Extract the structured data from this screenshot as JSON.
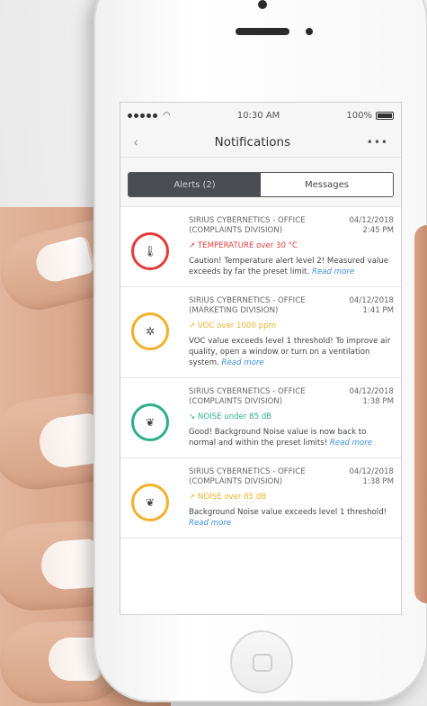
{
  "status_bar": {
    "time": "10:30 AM",
    "battery": "100%"
  },
  "nav": {
    "back": "‹",
    "title": "Notifications",
    "more": "•••"
  },
  "tabs": [
    {
      "label": "Alerts (2)",
      "active": true
    },
    {
      "label": "Messages",
      "active": false
    }
  ],
  "notifications": [
    {
      "org": "SIRIUS CYBERNETICS - OFFICE (COMPLAINTS DIVISION)",
      "date": "04/12/2018",
      "time": "2:45 PM",
      "metric": "↗ TEMPERATURE over 30 °C",
      "metric_color": "#e53b3b",
      "ring_color": "#e53b3b",
      "icon": "thermometer-icon",
      "glyph": "🌡",
      "description": "Caution! Temperature alert level 2! Measured value exceeds by far the preset limit.",
      "read_more": "Read more"
    },
    {
      "org": "SIRIUS CYBERNETICS - OFFICE (MARKETING DIVISION)",
      "date": "04/12/2018",
      "time": "1:41 PM",
      "metric": "↗ VOC over 1000 ppm",
      "metric_color": "#f2b12a",
      "ring_color": "#f2b12a",
      "icon": "voc-icon",
      "glyph": "✲",
      "description": "VOC value exceeds level 1 threshold! To improve air quality, open a window or turn on a ventilation system.",
      "read_more": "Read more"
    },
    {
      "org": "SIRIUS CYBERNETICS - OFFICE (COMPLAINTS DIVISION)",
      "date": "04/12/2018",
      "time": "1:38 PM",
      "metric": "↘ NOISE under 85 dB",
      "metric_color": "#2eae8a",
      "ring_color": "#2eae8a",
      "icon": "ear-icon",
      "glyph": "❦",
      "description": "Good! Background Noise value is now back to normal and within the preset limits!",
      "read_more": "Read more"
    },
    {
      "org": "SIRIUS CYBERNETICS - OFFICE (COMPLAINTS DIVISION)",
      "date": "04/12/2018",
      "time": "1:38 PM",
      "metric": "↗ NOISE over 85 dB",
      "metric_color": "#f2b12a",
      "ring_color": "#f2b12a",
      "icon": "ear-icon",
      "glyph": "❦",
      "description": "Background Noise value exceeds level 1 threshold!",
      "read_more": "Read more"
    }
  ]
}
